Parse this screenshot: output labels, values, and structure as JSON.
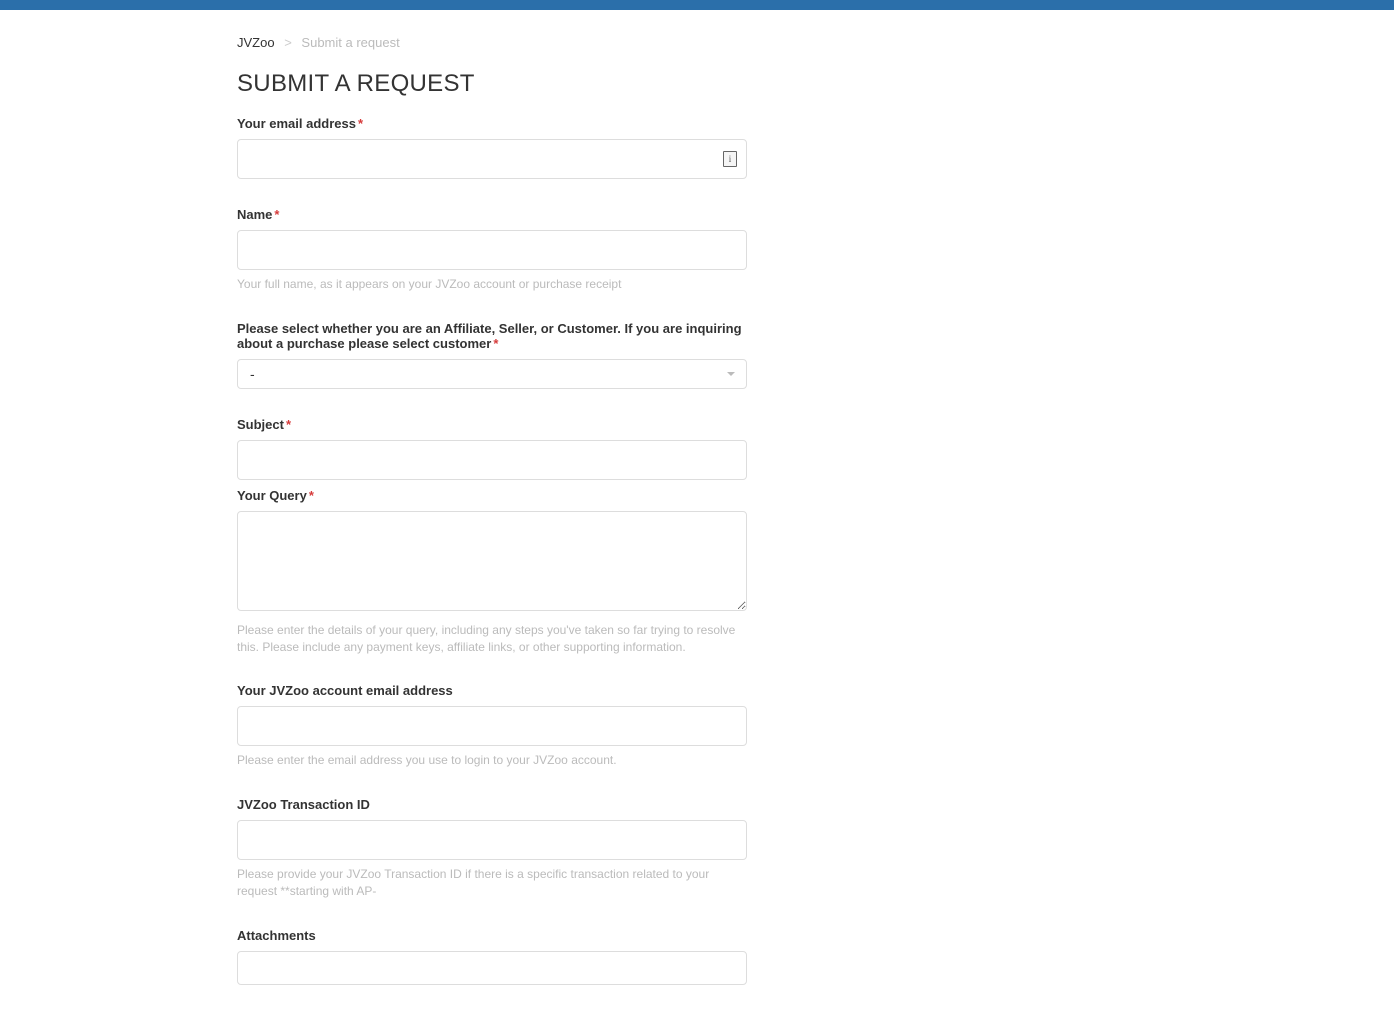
{
  "breadcrumb": {
    "root": "JVZoo",
    "separator": ">",
    "current": "Submit a request"
  },
  "page": {
    "title": "SUBMIT A REQUEST"
  },
  "form": {
    "email": {
      "label": "Your email address",
      "value": ""
    },
    "name": {
      "label": "Name",
      "value": "",
      "hint": "Your full name, as it appears on your JVZoo account or purchase receipt"
    },
    "role": {
      "label": "Please select whether you are an Affiliate, Seller, or Customer. If you are inquiring about a purchase please select customer",
      "selected": "-"
    },
    "subject": {
      "label": "Subject",
      "value": ""
    },
    "query": {
      "label": "Your Query",
      "value": "",
      "hint": "Please enter the details of your query, including any steps you've taken so far trying to resolve this. Please include any payment keys, affiliate links, or other supporting information."
    },
    "account_email": {
      "label": "Your JVZoo account email address",
      "value": "",
      "hint": "Please enter the email address you use to login to your JVZoo account."
    },
    "transaction_id": {
      "label": "JVZoo Transaction ID",
      "value": "",
      "hint": "Please provide your JVZoo Transaction ID if there is a specific transaction related to your request **starting with AP-"
    },
    "attachments": {
      "label": "Attachments"
    }
  }
}
